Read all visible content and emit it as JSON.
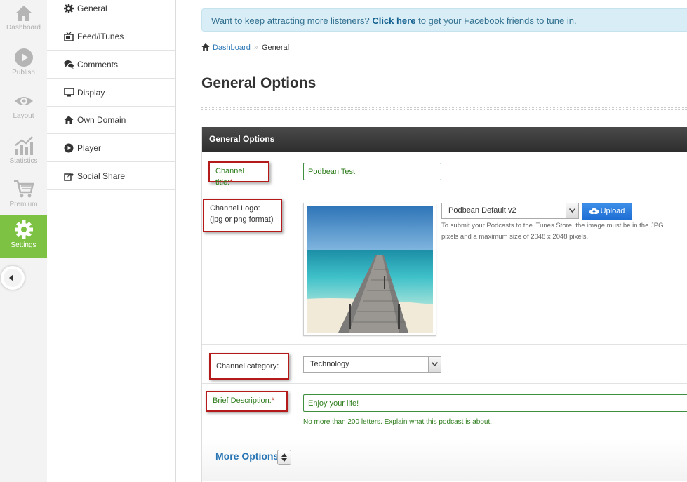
{
  "rail": {
    "items": [
      {
        "label": "Dashboard",
        "icon": "home-icon"
      },
      {
        "label": "Publish",
        "icon": "play-icon"
      },
      {
        "label": "Layout",
        "icon": "eye-icon"
      },
      {
        "label": "Statistics",
        "icon": "bar-chart-icon"
      },
      {
        "label": "Premium",
        "icon": "cart-icon"
      },
      {
        "label": "Settings",
        "icon": "gear-icon"
      }
    ],
    "active": "Settings"
  },
  "subnav": {
    "items": [
      {
        "label": "General",
        "icon": "gear-icon"
      },
      {
        "label": "Feed/iTunes",
        "icon": "tv-icon"
      },
      {
        "label": "Comments",
        "icon": "comments-icon"
      },
      {
        "label": "Display",
        "icon": "monitor-icon"
      },
      {
        "label": "Own Domain",
        "icon": "home-icon"
      },
      {
        "label": "Player",
        "icon": "play-icon"
      },
      {
        "label": "Social Share",
        "icon": "share-icon"
      }
    ]
  },
  "notice": {
    "prefix": "Want to keep attracting more listeners?",
    "link": "Click here",
    "suffix": "to get your Facebook friends to tune in."
  },
  "breadcrumb": {
    "home": "Dashboard",
    "separator": "»",
    "current": "General"
  },
  "page_title": "General Options",
  "panel": {
    "header": "General Options",
    "channel_title": {
      "label": "Channel title:",
      "required": "*",
      "value": "Podbean Test"
    },
    "channel_logo": {
      "label_line1": "Channel Logo:",
      "label_line2": "(jpg or png format)",
      "select_value": "Podbean Default v2",
      "upload_label": "Upload",
      "hint_line1": "To submit your Podcasts to the iTunes Store, the image must be in the JPG",
      "hint_line2": "pixels and a maximum size of 2048 x 2048 pixels."
    },
    "channel_category": {
      "label": "Channel category:",
      "value": "Technology"
    },
    "brief_description": {
      "label": "Brief Description:",
      "required": "*",
      "value": "Enjoy your life!",
      "hint": "No more than 200 letters. Explain what this podcast is about."
    },
    "more_options": "More Options"
  },
  "colors": {
    "accent_green": "#7dc242",
    "link_blue": "#2a76b5",
    "annotation_red": "#b51a1a"
  }
}
